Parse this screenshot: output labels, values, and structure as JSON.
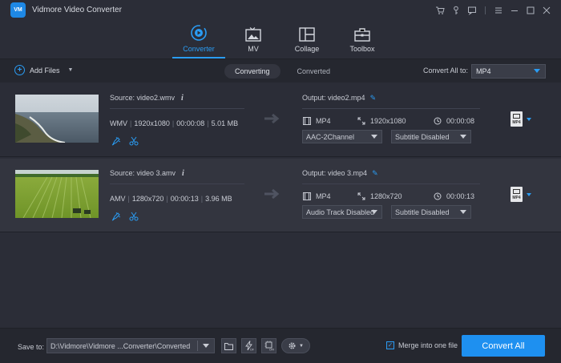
{
  "window": {
    "logo_text": "VM",
    "title": "Vidmore Video Converter",
    "icons": [
      "cart-icon",
      "key-icon",
      "chat-icon",
      "menu-icon",
      "minimize-icon",
      "maximize-icon",
      "close-icon"
    ]
  },
  "tabs": [
    {
      "label": "Converter",
      "icon": "converter-icon",
      "active": true
    },
    {
      "label": "MV",
      "icon": "mv-icon",
      "active": false
    },
    {
      "label": "Collage",
      "icon": "collage-icon",
      "active": false
    },
    {
      "label": "Toolbox",
      "icon": "toolbox-icon",
      "active": false
    }
  ],
  "toolbar": {
    "add_files": "Add Files",
    "segments": [
      "Converting",
      "Converted"
    ],
    "convert_all_to_label": "Convert All to:",
    "format": "MP4"
  },
  "files": [
    {
      "source": "Source: video2.wmv",
      "format": "WMV",
      "resolution": "1920x1080",
      "duration": "00:00:08",
      "size": "5.01 MB",
      "output": "Output: video2.mp4",
      "out_format": "MP4",
      "out_resolution": "1920x1080",
      "out_duration": "00:00:08",
      "audio": "AAC-2Channel",
      "subtitle": "Subtitle Disabled"
    },
    {
      "source": "Source: video 3.amv",
      "format": "AMV",
      "resolution": "1280x720",
      "duration": "00:00:13",
      "size": "3.96 MB",
      "output": "Output: video 3.mp4",
      "out_format": "MP4",
      "out_resolution": "1280x720",
      "out_duration": "00:00:13",
      "audio": "Audio Track Disabled",
      "subtitle": "Subtitle Disabled"
    }
  ],
  "bottom": {
    "save_to_label": "Save to:",
    "path": "D:\\Vidmore\\Vidmore ...Converter\\Converted",
    "merge_label": "Merge into one file",
    "merge_checked": true,
    "convert_all": "Convert All"
  },
  "colors": {
    "accent": "#2a9cf3",
    "background": "#2b2d37",
    "convert_button": "#1e90f0"
  }
}
